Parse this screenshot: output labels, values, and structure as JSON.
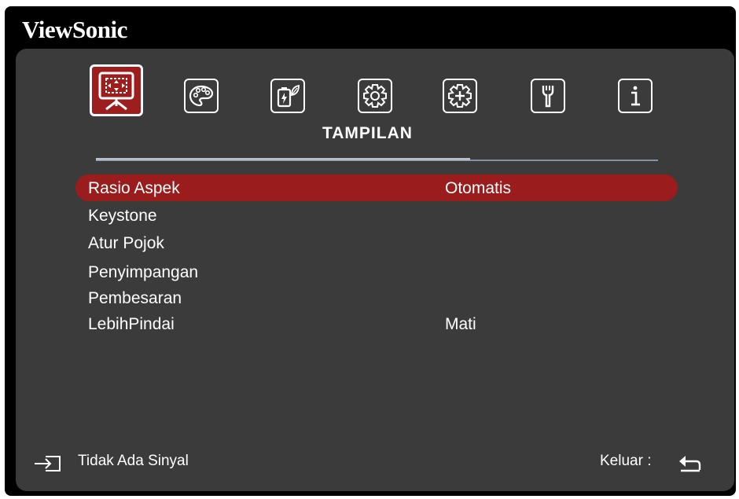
{
  "brand": "ViewSonic",
  "tabs": [
    {
      "icon": "display-icon",
      "active": true
    },
    {
      "icon": "palette-icon",
      "active": false
    },
    {
      "icon": "power-management-icon",
      "active": false
    },
    {
      "icon": "settings-gear-icon",
      "active": false
    },
    {
      "icon": "advanced-gear-icon",
      "active": false
    },
    {
      "icon": "wrench-icon",
      "active": false
    },
    {
      "icon": "info-icon",
      "active": false
    }
  ],
  "section_title": "TAMPILAN",
  "menu": [
    {
      "label": "Rasio Aspek",
      "value": "Otomatis",
      "selected": true
    },
    {
      "label": "Keystone",
      "value": ""
    },
    {
      "label": "Atur Pojok",
      "value": ""
    },
    {
      "label": "Penyimpangan",
      "value": ""
    },
    {
      "label": "Pembesaran",
      "value": ""
    },
    {
      "label": "LebihPindai",
      "value": "Mati"
    }
  ],
  "footer": {
    "source_icon": "input-source-icon",
    "source_status": "Tidak Ada Sinyal",
    "exit_label": "Keluar :",
    "exit_icon": "return-arrow-icon"
  },
  "colors": {
    "highlight": "#9b1c1c",
    "panel": "#3b3b3b",
    "frame": "#000000"
  }
}
